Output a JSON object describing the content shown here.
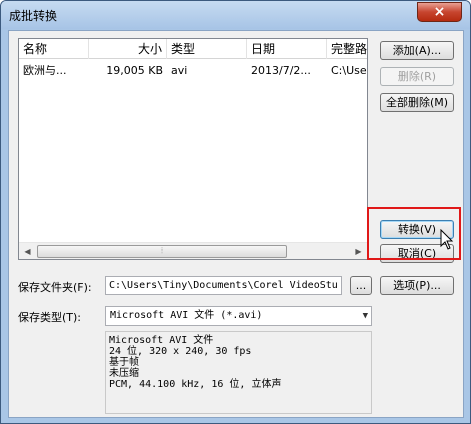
{
  "window": {
    "title": "成批转换",
    "close_label": "×"
  },
  "list": {
    "columns": [
      "名称",
      "大小",
      "类型",
      "日期",
      "完整路径"
    ],
    "rows": [
      {
        "name": "欧洲与...",
        "size": "19,005 KB",
        "type": "avi",
        "date": "2013/7/2...",
        "path": "C:\\User"
      }
    ],
    "scroll_left": "◀",
    "scroll_right": "▶",
    "scroll_grip": "⦙"
  },
  "buttons": {
    "add": "添加(A)...",
    "delete": "删除(R)",
    "delete_all": "全部删除(M)",
    "convert": "转换(V)",
    "cancel": "取消(C)",
    "options": "选项(P)...",
    "browse": "..."
  },
  "save_folder": {
    "label": "保存文件夹(F):",
    "value": "C:\\Users\\Tiny\\Documents\\Corel VideoStu"
  },
  "save_type": {
    "label": "保存类型(T):",
    "selected": "Microsoft AVI 文件 (*.avi)",
    "arrow": "▼"
  },
  "info": {
    "lines": [
      "Microsoft AVI 文件",
      "24 位, 320 x 240, 30 fps",
      "基于帧",
      "未压缩",
      "PCM, 44.100 kHz, 16 位, 立体声"
    ]
  },
  "colors": {
    "highlight": "#e01818",
    "close_button": "#c7452f",
    "title_bar": "#a7c4e6"
  }
}
